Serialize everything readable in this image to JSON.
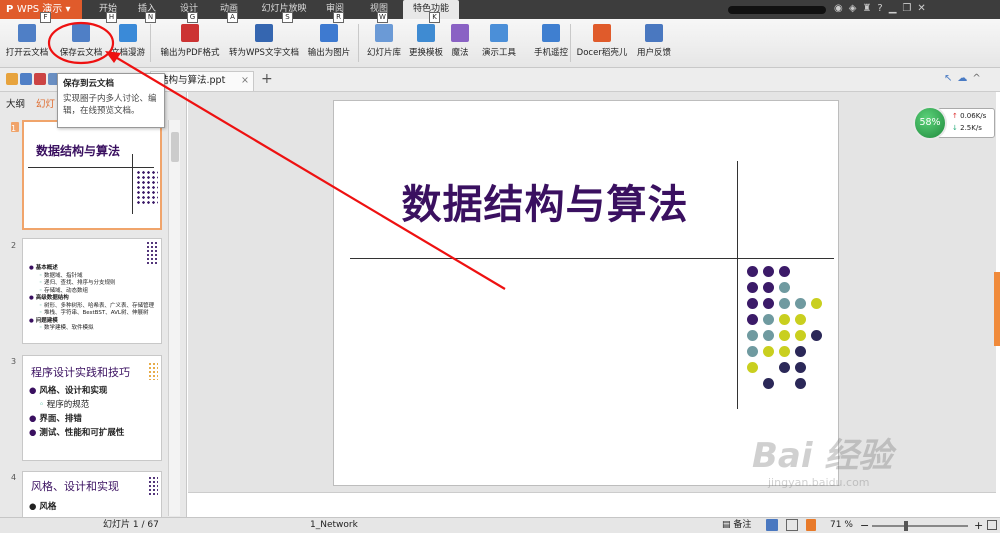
{
  "app": {
    "name": "WPS 演示"
  },
  "menu_tabs": [
    {
      "label": "开始",
      "key": "H"
    },
    {
      "label": "插入",
      "key": "N"
    },
    {
      "label": "设计",
      "key": "G"
    },
    {
      "label": "动画",
      "key": "A"
    },
    {
      "label": "幻灯片放映",
      "key": "S"
    },
    {
      "label": "审阅",
      "key": "R"
    },
    {
      "label": "视图",
      "key": "W"
    },
    {
      "label": "特色功能",
      "key": "K"
    }
  ],
  "app_key": "F",
  "ribbon": [
    {
      "label": "打开云文档",
      "icon": "cloud-open-icon"
    },
    {
      "label": "保存云文档",
      "icon": "cloud-save-icon"
    },
    {
      "label": "文档漫游",
      "icon": "roaming-icon"
    },
    {
      "label": "输出为PDF格式",
      "icon": "pdf-icon"
    },
    {
      "label": "转为WPS文字文档",
      "icon": "convert-icon"
    },
    {
      "label": "输出为图片",
      "icon": "image-export-icon"
    },
    {
      "label": "幻灯片库",
      "icon": "slide-library-icon"
    },
    {
      "label": "更换模板",
      "icon": "template-icon"
    },
    {
      "label": "魔法",
      "icon": "magic-icon"
    },
    {
      "label": "演示工具",
      "icon": "presentation-tools-icon"
    },
    {
      "label": "手机遥控",
      "icon": "phone-remote-icon"
    },
    {
      "label": "Docer稻壳儿",
      "icon": "docer-icon"
    },
    {
      "label": "用户反馈",
      "icon": "feedback-icon"
    }
  ],
  "doc_tab": {
    "name": "结构与算法.ppt"
  },
  "pane_tabs": [
    "大纲",
    "幻灯"
  ],
  "tooltip": {
    "title": "保存到云文档",
    "body": "实现圈子内多人讨论、编辑，在线预览文档。"
  },
  "thumbnails": [
    {
      "num": "1",
      "title": "数据结构与算法"
    },
    {
      "num": "2",
      "lines": [
        "基本概述",
        "数据域、指针域",
        "递归、查找、排序与分支规则",
        "存储域、动态数组",
        "高级数据结构",
        "树形、多种树形、哈希表、广义表、存储管理",
        "堆栈、字符串、BestBST、AVL树、伸展树",
        "问题建模",
        "数学建模、软件模拟"
      ]
    },
    {
      "num": "3",
      "title": "程序设计实践和技巧",
      "lines": [
        "风格、设计和实现",
        "程序的规范",
        "界面、排错",
        "测试、性能和可扩展性"
      ]
    },
    {
      "num": "4",
      "title": "风格、设计和实现",
      "lines": [
        "风格"
      ]
    }
  ],
  "slide": {
    "title": "数据结构与算法"
  },
  "dot_colors": {
    "purple": "#3b1a68",
    "teal": "#6f9aa0",
    "yellow": "#c9cf1f",
    "navy": "#2b2858"
  },
  "dots": [
    [
      "purple",
      "purple",
      "purple",
      "",
      ""
    ],
    [
      "purple",
      "purple",
      "teal",
      "",
      ""
    ],
    [
      "purple",
      "purple",
      "teal",
      "teal",
      "yellow"
    ],
    [
      "purple",
      "teal",
      "yellow",
      "yellow",
      ""
    ],
    [
      "teal",
      "teal",
      "yellow",
      "yellow",
      "navy"
    ],
    [
      "teal",
      "yellow",
      "yellow",
      "navy",
      ""
    ],
    [
      "yellow",
      "",
      "navy",
      "navy",
      ""
    ],
    [
      "",
      "navy",
      "",
      "navy",
      ""
    ]
  ],
  "net": {
    "percent": "58%",
    "up": "0.06K/s",
    "down": "2.5K/s"
  },
  "status": {
    "slide": "幻灯片 1 / 67",
    "template": "1_Network",
    "notes": "备注",
    "zoom": "71 %"
  },
  "watermark": {
    "text": "Bai 经验",
    "url": "jingyan.baidu.com"
  },
  "accent": "#e05b2b"
}
